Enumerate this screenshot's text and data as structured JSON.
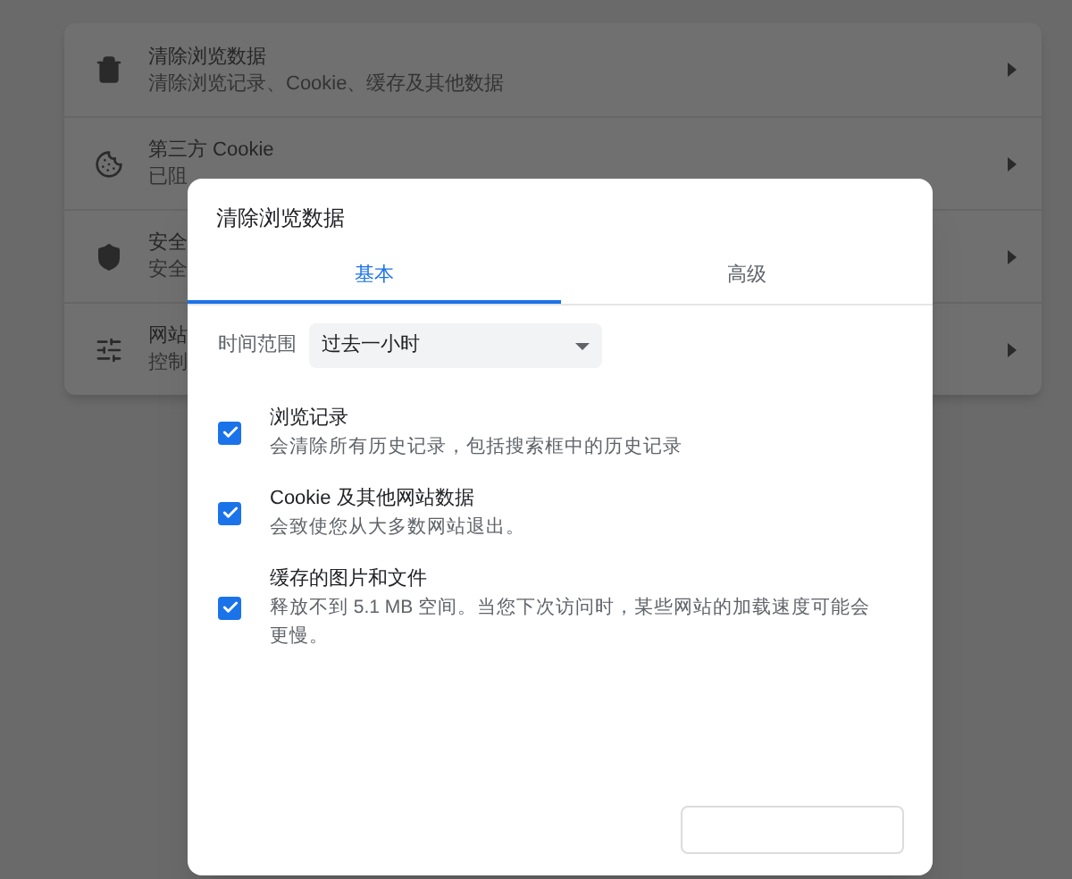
{
  "settings_rows": [
    {
      "kind": "trash",
      "title": "清除浏览数据",
      "subtitle": "清除浏览记录、Cookie、缓存及其他数据"
    },
    {
      "kind": "cookie",
      "title": "第三方 Cookie",
      "subtitle": "已阻"
    },
    {
      "kind": "shield",
      "title": "安全",
      "subtitle": "安全"
    },
    {
      "kind": "sliders",
      "title": "网站",
      "subtitle": "控制"
    }
  ],
  "dialog": {
    "title": "清除浏览数据",
    "tabs": [
      {
        "label": "基本",
        "selected": true
      },
      {
        "label": "高级",
        "selected": false
      }
    ],
    "time_range": {
      "label": "时间范围",
      "value": "过去一小时"
    },
    "options": [
      {
        "title": "浏览记录",
        "description": "会清除所有历史记录，包括搜索框中的历史记录",
        "checked": true
      },
      {
        "title": "Cookie 及其他网站数据",
        "description": "会致使您从大多数网站退出。",
        "checked": true
      },
      {
        "title": "缓存的图片和文件",
        "description": "释放不到 5.1 MB 空间。当您下次访问时，某些网站的加载速度可能会更慢。",
        "checked": true
      }
    ]
  }
}
